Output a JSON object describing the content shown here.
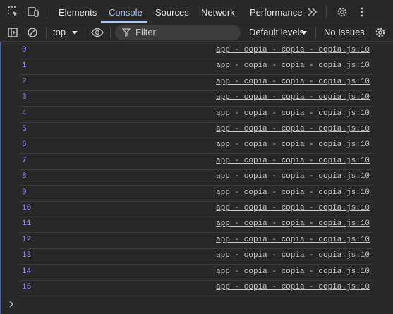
{
  "tabs": [
    {
      "label": "Elements"
    },
    {
      "label": "Console"
    },
    {
      "label": "Sources"
    },
    {
      "label": "Network"
    },
    {
      "label": "Performance"
    }
  ],
  "active_tab": "Console",
  "toolbar": {
    "context": "top",
    "filter_placeholder": "Filter",
    "levels": "Default levels",
    "issues": "No Issues"
  },
  "log": {
    "source": "app - copia - copia - copia.js:10",
    "messages": [
      "0",
      "1",
      "2",
      "3",
      "4",
      "5",
      "6",
      "7",
      "8",
      "9",
      "10",
      "11",
      "12",
      "13",
      "14",
      "15"
    ]
  },
  "colors": {
    "accent": "#a8c7fa",
    "log_value": "#9e91ff"
  },
  "icons": [
    "inspect-element-icon",
    "device-toolbar-icon",
    "more-tabs-icon",
    "settings-icon",
    "more-options-icon",
    "sidebar-toggle-icon",
    "clear-console-icon",
    "dropdown-arrow-icon",
    "live-expression-icon",
    "filter-icon",
    "console-settings-icon",
    "prompt-chevron-icon"
  ]
}
